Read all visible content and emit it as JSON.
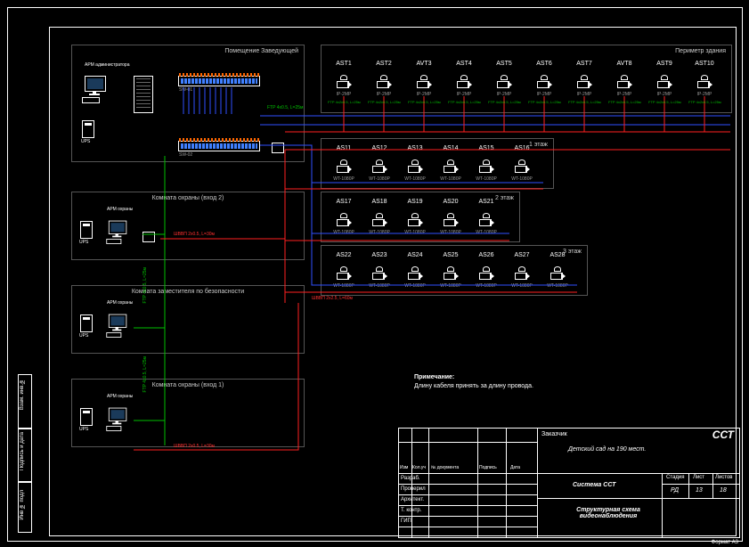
{
  "rooms": {
    "manager": "Помещение Заведующей",
    "perimeter": "Периметр здания",
    "floor1": "1 этаж",
    "floor2": "2 этаж",
    "floor3": "3 этаж",
    "guard2": "Комната охраны (вход 2)",
    "deputy": "Комната заместителя по безопасности",
    "guard1": "Комната охраны (вход 1)"
  },
  "ws": {
    "arm": "АРМ охраны",
    "arm_adm": "АРМ администратора"
  },
  "ups": "UPS",
  "switch1": "SW-01",
  "switch2": "SW-02",
  "cameras": {
    "perimeter": [
      {
        "id": "AST1",
        "m": "IP-2MP"
      },
      {
        "id": "AST2",
        "m": "IP-2MP"
      },
      {
        "id": "AVT3",
        "m": "IP-2MP"
      },
      {
        "id": "AST4",
        "m": "IP-2MP"
      },
      {
        "id": "AST5",
        "m": "IP-2MP"
      },
      {
        "id": "AST6",
        "m": "IP-2MP"
      },
      {
        "id": "AST7",
        "m": "IP-2MP"
      },
      {
        "id": "AVT8",
        "m": "IP-2MP"
      },
      {
        "id": "AST9",
        "m": "IP-2MP"
      },
      {
        "id": "AST10",
        "m": "IP-2MP"
      }
    ],
    "f1": [
      {
        "id": "AS11",
        "m": "WT-1080P"
      },
      {
        "id": "AS12",
        "m": "WT-1080P"
      },
      {
        "id": "AS13",
        "m": "WT-1080P"
      },
      {
        "id": "AS14",
        "m": "WT-1080P"
      },
      {
        "id": "AS15",
        "m": "WT-1080P"
      },
      {
        "id": "AS16",
        "m": "WT-1080P"
      }
    ],
    "f2": [
      {
        "id": "AS17",
        "m": "WT-1080P"
      },
      {
        "id": "AS18",
        "m": "WT-1080P"
      },
      {
        "id": "AS19",
        "m": "WT-1080P"
      },
      {
        "id": "AS20",
        "m": "WT-1080P"
      },
      {
        "id": "AS21",
        "m": "WT-1080P"
      }
    ],
    "f3": [
      {
        "id": "AS22",
        "m": "WT-1080P"
      },
      {
        "id": "AS23",
        "m": "WT-1080P"
      },
      {
        "id": "AS24",
        "m": "WT-1080P"
      },
      {
        "id": "AS25",
        "m": "WT-1080P"
      },
      {
        "id": "AS26",
        "m": "WT-1080P"
      },
      {
        "id": "AS27",
        "m": "WT-1080P"
      },
      {
        "id": "AS28",
        "m": "WT-1080P"
      }
    ]
  },
  "cable_notes": {
    "ftp_green": "FTP 4x0.5, L=25м",
    "ftp_blue": "FTP 4x2x0.5, L=25м ×10",
    "pwr_red": "ШВВП 2x0.5, L=30м",
    "bus_red": "ШВВП 2x2.5, L=60м"
  },
  "note": {
    "title": "Примечание:",
    "body": "Длину кабеля принять за длину провода."
  },
  "titleblock": {
    "customer": "Заказчик",
    "company": "ССТ",
    "project_line": "Детский сад на 190 мест.",
    "system": "Система ССТ",
    "drawing": "Структурная схема видеонаблюдения",
    "stage_h": "Стадия",
    "sheet_h": "Лист",
    "sheets_h": "Листов",
    "stage": "РД",
    "sheet": "13",
    "sheets": "18",
    "cols": {
      "izm": "Изм",
      "kuch": "Кол.уч",
      "ndoc": "№ документа",
      "sign": "Подпись",
      "date": "Дата"
    },
    "rows": {
      "razrab": "Разраб.",
      "proveril": "Проверил",
      "arhit": "Архитект.",
      "tkontr": "Т. контр.",
      "gip": "ГИП"
    },
    "format": "Формат А3"
  },
  "side": {
    "inv": "Инв № подл",
    "sign": "Подпись и дата",
    "vzam": "Взам. инв.№"
  }
}
